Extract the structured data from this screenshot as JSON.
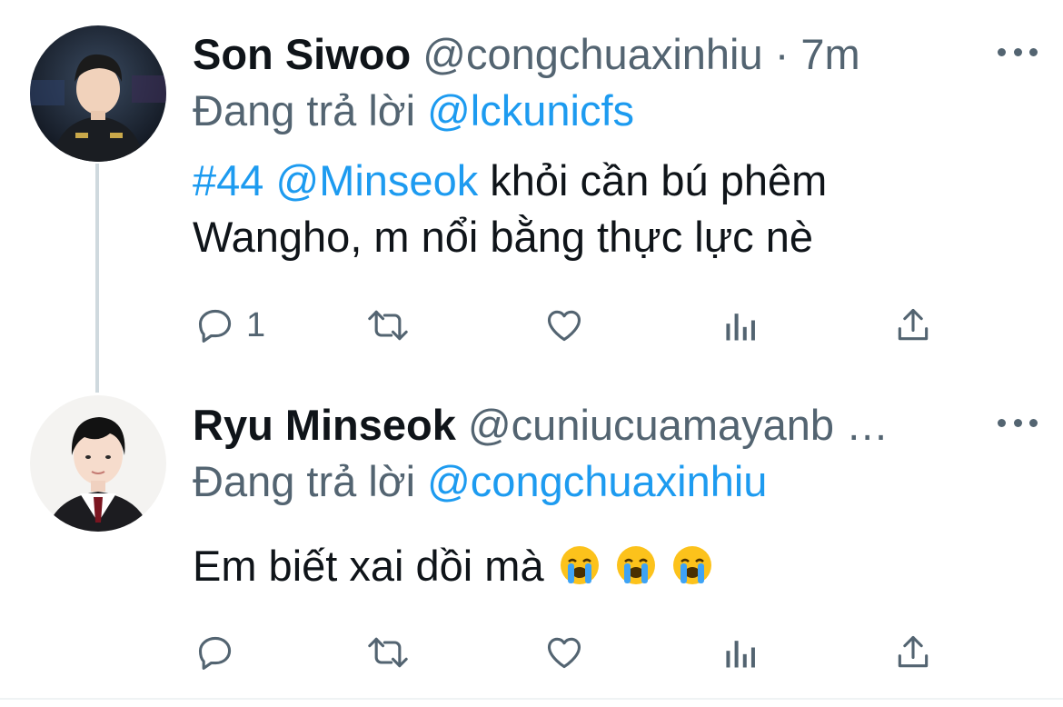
{
  "tweets": [
    {
      "name": "Son Siwoo",
      "handle": "@congchuaxinhiu",
      "separator": "·",
      "time": "7m",
      "replying_prefix": "Đang trả lời",
      "replying_to": "@lckunicfs",
      "body_hashtag": "#44",
      "body_mention": "@Minseok",
      "body_line1_rest": " khỏi cần bú phêm",
      "body_line2": "Wangho, m nổi bằng thực lực nè",
      "reply_count": "1"
    },
    {
      "name": "Ryu Minseok",
      "handle": "@cuniucuamayanb …",
      "replying_prefix": "Đang trả lời",
      "replying_to": "@congchuaxinhiu",
      "body_text": "Em biết xai dồi mà"
    }
  ],
  "icons": {
    "reply": "reply-icon",
    "retweet": "retweet-icon",
    "like": "heart-icon",
    "analytics": "analytics-icon",
    "share": "share-icon",
    "more": "more-icon",
    "emoji": "loudly-crying-face-emoji"
  },
  "colors": {
    "text": "#0f1419",
    "secondary": "#536471",
    "link": "#1d9bf0",
    "thread_line": "#cfd9de"
  }
}
